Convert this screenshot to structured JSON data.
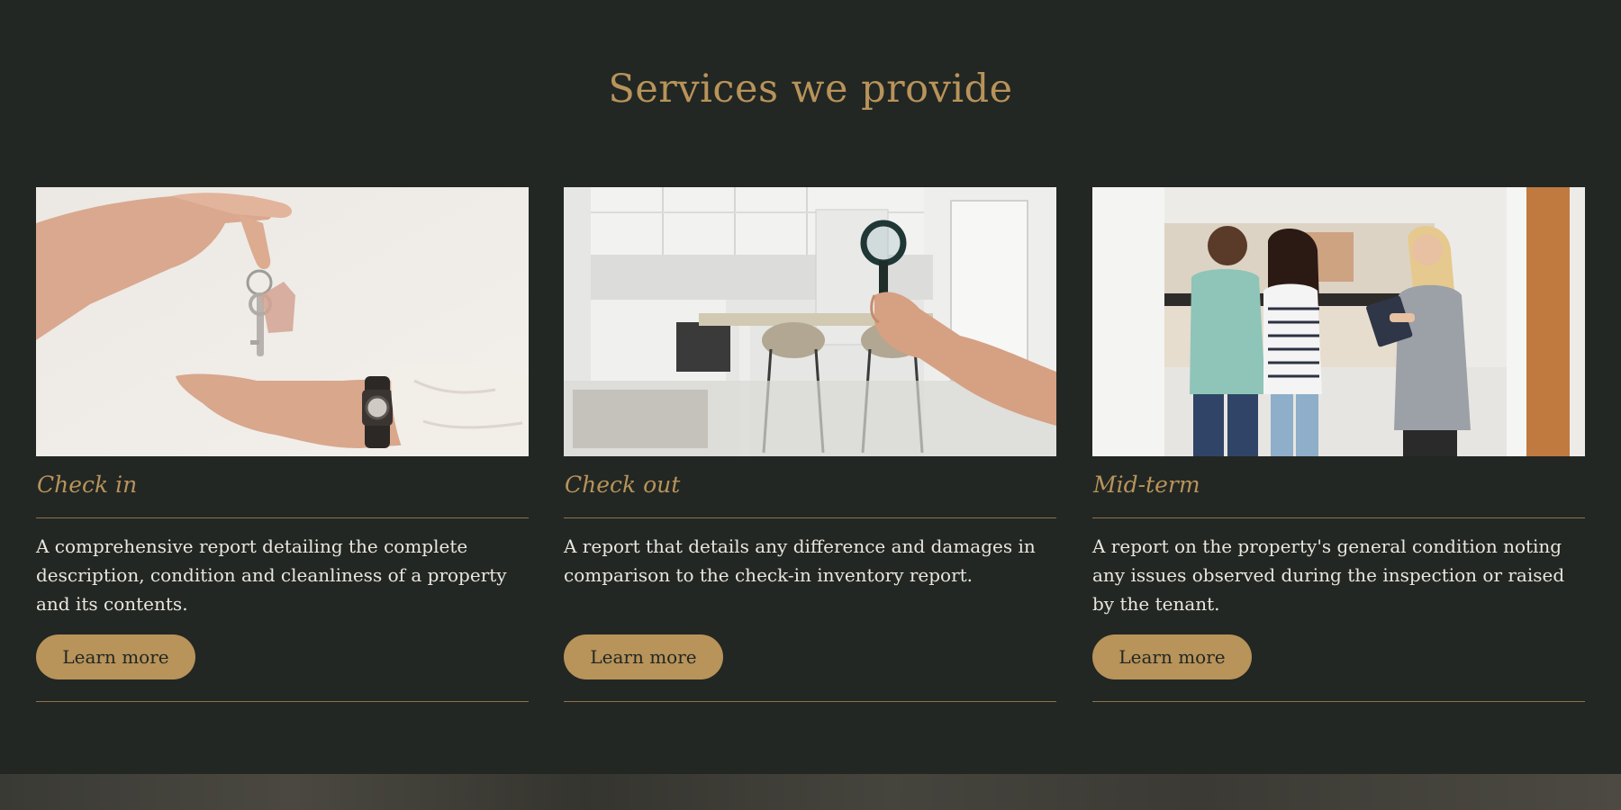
{
  "section": {
    "title": "Services we provide"
  },
  "cards": [
    {
      "image_alt": "hand passing house keys to another hand",
      "title": "Check in",
      "description": "A comprehensive report detailing the complete description, condition and cleanliness of a property and its contents.",
      "button_label": "Learn more"
    },
    {
      "image_alt": "hand holding a magnifying glass in a modern kitchen",
      "title": "Check out",
      "description": "A report that details any difference and damages in comparison to the check-in inventory report.",
      "button_label": "Learn more"
    },
    {
      "image_alt": "couple viewing a property with an agent holding a clipboard",
      "title": "Mid-term",
      "description": "A report on the property's general condition noting any issues observed during the inspection or raised by the tenant.",
      "button_label": "Learn more"
    }
  ],
  "colors": {
    "background": "#222723",
    "accent": "#b8935a",
    "text": "#eae6de",
    "divider": "#8e734b"
  }
}
